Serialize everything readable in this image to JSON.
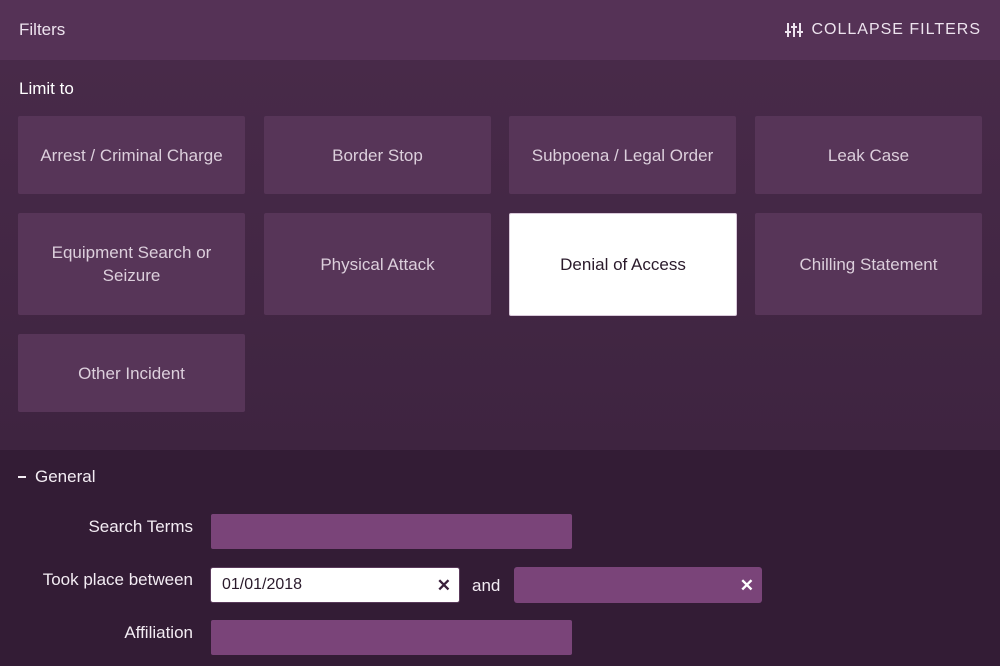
{
  "header": {
    "title": "Filters",
    "collapse_label": "COLLAPSE FILTERS",
    "collapse_icon": "sliders-icon"
  },
  "limit": {
    "label": "Limit to",
    "tiles": [
      {
        "label": "Arrest / Criminal Charge",
        "selected": false
      },
      {
        "label": "Border Stop",
        "selected": false
      },
      {
        "label": "Subpoena / Legal Order",
        "selected": false
      },
      {
        "label": "Leak Case",
        "selected": false
      },
      {
        "label": "Equipment Search or Seizure",
        "selected": false
      },
      {
        "label": "Physical Attack",
        "selected": false
      },
      {
        "label": "Denial of Access",
        "selected": true
      },
      {
        "label": "Chilling Statement",
        "selected": false
      },
      {
        "label": "Other Incident",
        "selected": false
      }
    ]
  },
  "general": {
    "toggle_label": "General",
    "search_terms": {
      "label": "Search Terms",
      "value": ""
    },
    "took_place": {
      "label": "Took place between",
      "start_value": "01/01/2018",
      "and_label": "and",
      "end_value": ""
    },
    "affiliation": {
      "label": "Affiliation",
      "value": ""
    }
  },
  "colors": {
    "header_bg": "#553256",
    "tile_bg": "#573558",
    "input_bg": "#7a4479",
    "panel_bg": "#331c35"
  }
}
